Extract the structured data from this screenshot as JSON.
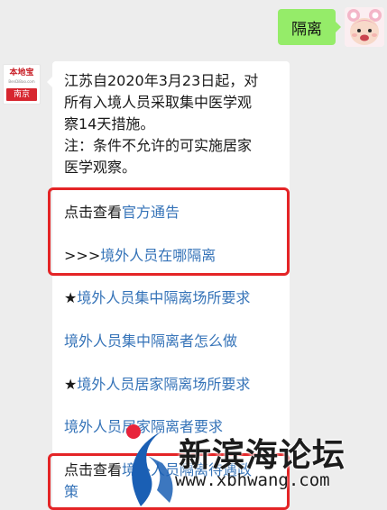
{
  "chat": {
    "outgoing_message": "隔离",
    "sender_logo_top": "本地宝",
    "sender_logo_mid": "BenDiBao.com",
    "sender_logo_bottom": "南京",
    "intro_line1": "江苏自2020年3月23日起，对",
    "intro_line2": "所有入境人员采取集中医学观",
    "intro_line3": "察14天措施。",
    "intro_line4": "注：条件不允许的可实施居家",
    "intro_line5": "医学观察。",
    "prefix_view": "点击查看",
    "link_official_notice": "官方通告",
    "prefix_arrows": ">>>",
    "link_where_quarantine": "境外人员在哪隔离",
    "star": "★",
    "link_centralized_site_req": "境外人员集中隔离场所要求",
    "link_centralized_how": "境外人员集中隔离者怎么做",
    "link_home_site_req": "境外人员居家隔离场所要求",
    "link_home_partial": "境外人员居家隔离者要求",
    "link_last_part1": "境外人员隔离待遇政",
    "link_last_part2": "策"
  },
  "watermark": {
    "title": "新滨海论坛",
    "url": "www.xbhwang.com"
  },
  "colors": {
    "chat_background": "#ededed",
    "outgoing_bubble": "#95ec69",
    "link": "#3573b8",
    "highlight": "#e42426",
    "watermark_blue": "#1a5fb4",
    "watermark_red": "#e8233a"
  }
}
